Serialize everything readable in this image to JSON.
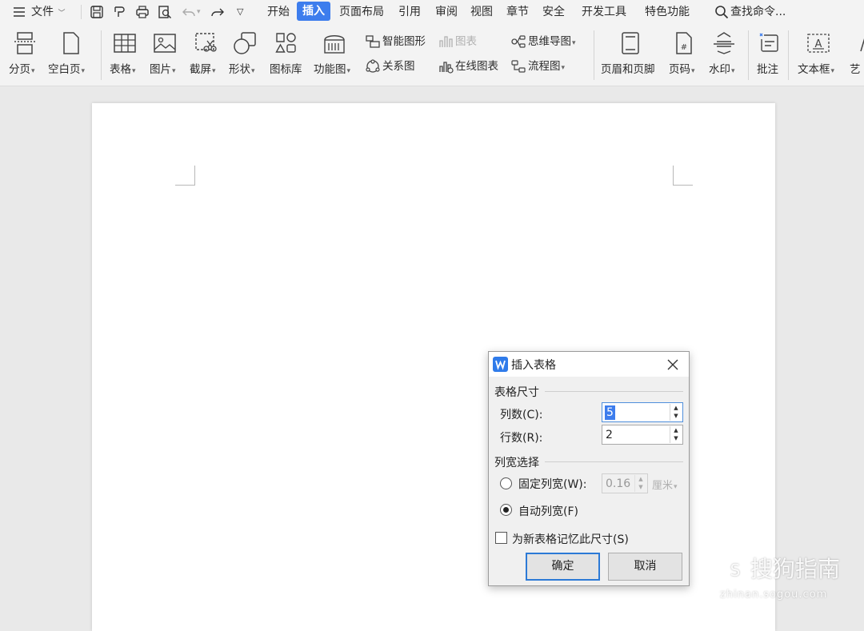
{
  "menubar": {
    "file_label": "文件",
    "tabs": [
      "开始",
      "插入",
      "页面布局",
      "引用",
      "审阅",
      "视图",
      "章节",
      "安全",
      "开发工具",
      "特色功能"
    ],
    "active_tab": "插入",
    "search_label": "查找命令..."
  },
  "ribbon": {
    "page_break": "分页",
    "blank_page": "空白页",
    "table": "表格",
    "picture": "图片",
    "screenshot": "截屏",
    "shapes": "形状",
    "icon_library": "图标库",
    "function_chart": "功能图",
    "smart_graphic": "智能图形",
    "chart": "图表",
    "mind_map": "思维导图",
    "relation_chart": "关系图",
    "online_chart": "在线图表",
    "flowchart": "流程图",
    "header_footer": "页眉和页脚",
    "page_number": "页码",
    "watermark": "水印",
    "comment": "批注",
    "textbox": "文本框",
    "art": "艺"
  },
  "dialog": {
    "title": "插入表格",
    "size_group": "表格尺寸",
    "columns_label": "列数(C):",
    "columns_value": "5",
    "rows_label": "行数(R):",
    "rows_value": "2",
    "width_group": "列宽选择",
    "fixed_width_label": "固定列宽(W):",
    "fixed_width_value": "0.16",
    "unit": "厘米",
    "auto_width_label": "自动列宽(F)",
    "remember_label": "为新表格记忆此尺寸(S)",
    "ok": "确定",
    "cancel": "取消"
  },
  "watermark": {
    "text": "搜狗指南",
    "url": "zhinan.sogou.com"
  },
  "colors": {
    "accent": "#3d7ded",
    "ribbon_bg": "#f3f3f3",
    "canvas_bg": "#e9e9e9"
  }
}
